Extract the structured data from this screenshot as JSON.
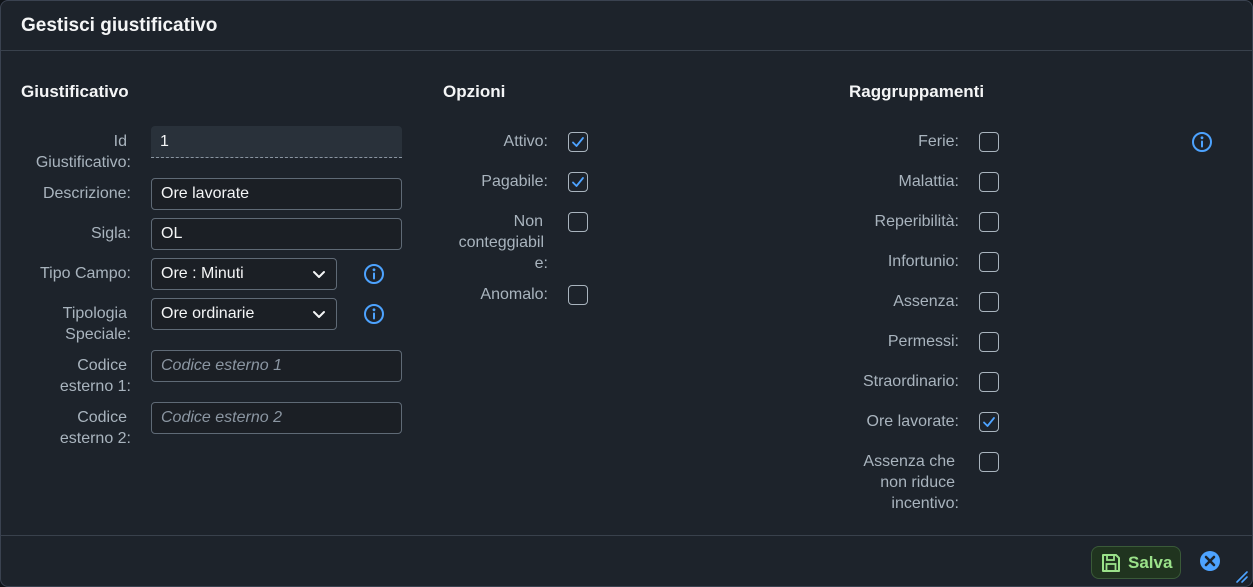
{
  "dialog": {
    "title": "Gestisci giustificativo"
  },
  "sections": {
    "giustificativo": "Giustificativo",
    "opzioni": "Opzioni",
    "raggruppamenti": "Raggruppamenti"
  },
  "giustificativo": {
    "id_label_1": "Id",
    "id_label_2": "Giustificativo:",
    "id_value": "1",
    "descrizione_label": "Descrizione:",
    "descrizione_value": "Ore lavorate",
    "sigla_label": "Sigla:",
    "sigla_value": "OL",
    "tipo_campo_label": "Tipo Campo:",
    "tipo_campo_value": "Ore : Minuti",
    "tipologia_label_1": "Tipologia",
    "tipologia_label_2": "Speciale:",
    "tipologia_value": "Ore ordinarie",
    "codice1_label_1": "Codice",
    "codice1_label_2": "esterno 1:",
    "codice1_placeholder": "Codice esterno 1",
    "codice2_label_1": "Codice",
    "codice2_label_2": "esterno 2:",
    "codice2_placeholder": "Codice esterno 2"
  },
  "opzioni": {
    "attivo_label": "Attivo:",
    "attivo_checked": true,
    "pagabile_label": "Pagabile:",
    "pagabile_checked": true,
    "non_cont_label_1": "Non",
    "non_cont_label_2": "conteggiabil",
    "non_cont_label_3": "e:",
    "non_cont_checked": false,
    "anomalo_label": "Anomalo:",
    "anomalo_checked": false
  },
  "raggruppamenti": {
    "ferie_label": "Ferie:",
    "malattia_label": "Malattia:",
    "reperibilita_label": "Reperibilità:",
    "infortunio_label": "Infortunio:",
    "assenza_label": "Assenza:",
    "permessi_label": "Permessi:",
    "straordinario_label": "Straordinario:",
    "ore_lavorate_label": "Ore lavorate:",
    "ore_lavorate_checked": true,
    "assenza_incentivo_label_1": "Assenza che",
    "assenza_incentivo_label_2": "non riduce",
    "assenza_incentivo_label_3": "incentivo:"
  },
  "footer": {
    "save_label": "Salva"
  },
  "colors": {
    "accent": "#4da3ff",
    "save_text": "#9be28a",
    "save_bg": "#20341f"
  }
}
